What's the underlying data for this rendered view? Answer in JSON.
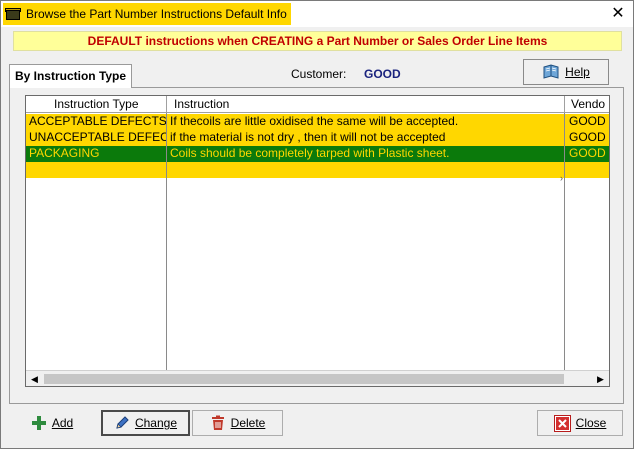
{
  "window": {
    "title": "Browse the Part Number Instructions Default Info",
    "close_glyph": "✕"
  },
  "banner": "DEFAULT instructions when CREATING a Part Number or Sales Order Line Items",
  "tab": {
    "label": "By Instruction Type"
  },
  "customer": {
    "label": "Customer:",
    "value": "GOOD"
  },
  "buttons": {
    "help": "Help",
    "add": "Add",
    "change": "Change",
    "delete": "Delete",
    "close": "Close"
  },
  "grid": {
    "columns": [
      "Instruction Type",
      "Instruction",
      "Vendo"
    ],
    "rows": [
      {
        "type": "ACCEPTABLE DEFECTS",
        "instruction": "If thecoils are little oxidised the same will be accepted.",
        "vendor": "GOOD",
        "selected": false
      },
      {
        "type": "UNACCEPTABLE DEFECTS",
        "instruction": "if the material is not dry , then it will not be accepted",
        "vendor": "GOOD",
        "selected": false
      },
      {
        "type": "PACKAGING",
        "instruction": "Coils should be completely tarped with Plastic sheet.",
        "vendor": "GOOD",
        "selected": true
      }
    ]
  },
  "colors": {
    "row_bg": "#ffd700",
    "selected_bg": "#0b7a0b",
    "selected_text": "#ffd700",
    "banner_bg": "#ffff99",
    "banner_text": "#c00000"
  },
  "icons": {
    "app": "box-icon",
    "help": "book-icon",
    "add": "plus-icon",
    "change": "pencil-icon",
    "delete": "trash-icon",
    "close": "close-box-icon"
  }
}
